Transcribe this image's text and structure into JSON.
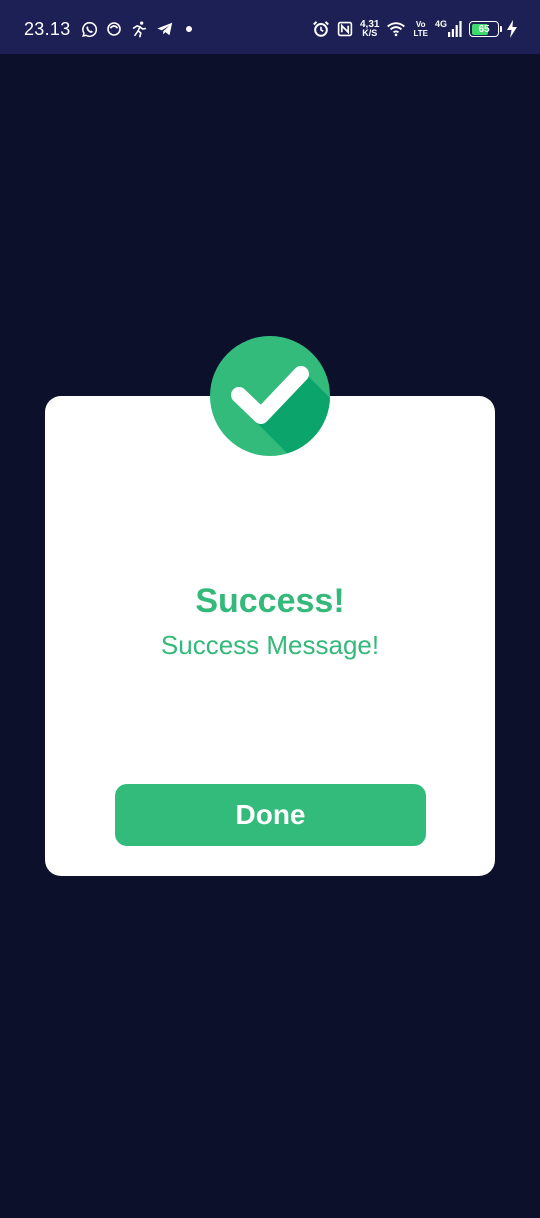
{
  "status_bar": {
    "time": "23.13",
    "left_icons": [
      "whatsapp-icon",
      "messenger-icon",
      "fitness-icon",
      "telegram-icon",
      "notification-dot-icon"
    ],
    "network_speed_value": "4,31",
    "network_speed_unit": "K/S",
    "volte_top": "Vo",
    "volte_bottom": "LTE",
    "network_type": "4G",
    "battery_level": "65",
    "battery_fraction": 0.65
  },
  "dialog": {
    "icon": "check-circle-icon",
    "title": "Success!",
    "message": "Success Message!",
    "button_label": "Done"
  },
  "colors": {
    "background": "#0d102b",
    "status_bar": "#1c2055",
    "accent_green": "#33bb7b",
    "card": "#ffffff"
  }
}
